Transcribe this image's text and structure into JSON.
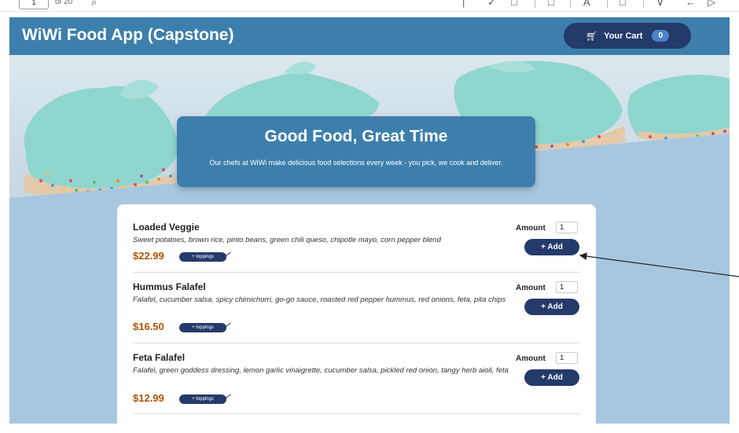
{
  "viewer": {
    "page_number": "1",
    "page_count": "of 20"
  },
  "app": {
    "title": "WiWi Food App (Capstone)",
    "cart_label": "Your Cart",
    "cart_count": "0",
    "cart_icon": "shopping-cart-icon"
  },
  "banner": {
    "title": "Good Food, Great Time",
    "subtitle": "Our chefs at WiWi make delicious food selections every week - you pick, we cook and deliver."
  },
  "meals": [
    {
      "name": "Loaded Veggie",
      "description": "Sweet potatoes, brown rice, pinto beans, green chili queso, chipotle mayo, corn pepper blend",
      "price": "$22.99",
      "toppings_label": "+ toppings",
      "amount_label": "Amount",
      "amount_value": "1",
      "add_label": "+ Add"
    },
    {
      "name": "Hummus Falafel",
      "description": "Falafel, cucumber salsa, spicy chimichurri, go-go sauce, roasted red pepper hummus, red onions, feta, pita chips",
      "price": "$16.50",
      "toppings_label": "+ toppings",
      "amount_label": "Amount",
      "amount_value": "1",
      "add_label": "+ Add"
    },
    {
      "name": "Feta Falafel",
      "description": "Falafel, green goddess dressing, lemon garlic vinaigrette, cucumber salsa, pickled red onion, tangy herb aioli, feta",
      "price": "$12.99",
      "toppings_label": "+ toppings",
      "amount_label": "Amount",
      "amount_value": "1",
      "add_label": "+ Add"
    }
  ],
  "colors": {
    "header": "#3d7fac",
    "page_background": "#a7c7e0",
    "button": "#243a6b",
    "price": "#ad5502",
    "frosting": "#8fd6cf"
  }
}
